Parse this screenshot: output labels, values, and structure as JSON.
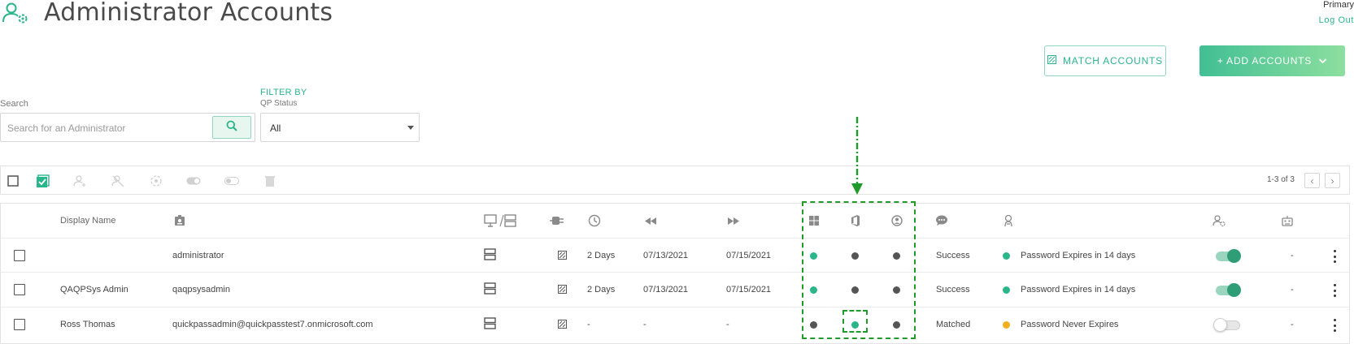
{
  "header": {
    "title": "Administrator Accounts",
    "account_label": "Primary",
    "logout_label": "Log Out"
  },
  "actions": {
    "match_label": "MATCH ACCOUNTS",
    "add_label": "+ ADD ACCOUNTS"
  },
  "search": {
    "label": "Search",
    "placeholder": "Search for an Administrator",
    "value": ""
  },
  "filter": {
    "heading": "FILTER BY",
    "label": "QP Status",
    "selected": "All"
  },
  "toolbar": {
    "page_count": "1-3 of 3"
  },
  "table": {
    "headers": {
      "display_name": "Display Name"
    },
    "rows": [
      {
        "display_name": "",
        "username": "administrator",
        "interval": "2 Days",
        "last_reset": "07/13/2021",
        "next_reset": "07/15/2021",
        "windows": "green",
        "office": "gray",
        "azure": "gray",
        "status": "Success",
        "password_dot": "green",
        "password": "Password Expires in 14 days",
        "enabled": true,
        "admin": "-"
      },
      {
        "display_name": "QAQPSys Admin",
        "username": "qaqpsysadmin",
        "interval": "2 Days",
        "last_reset": "07/13/2021",
        "next_reset": "07/15/2021",
        "windows": "green",
        "office": "gray",
        "azure": "gray",
        "status": "Success",
        "password_dot": "green",
        "password": "Password Expires in 14 days",
        "enabled": true,
        "admin": "-"
      },
      {
        "display_name": "Ross Thomas",
        "username": "quickpassadmin@quickpasstest7.onmicrosoft.com",
        "interval": "-",
        "last_reset": "-",
        "next_reset": "-",
        "windows": "gray",
        "office": "green",
        "azure": "gray",
        "status": "Matched",
        "password_dot": "yellow",
        "password": "Password Never Expires",
        "enabled": false,
        "admin": "-"
      }
    ]
  },
  "colors": {
    "accent": "#2bb58a",
    "green": "#2bb58a",
    "gray": "#555555",
    "yellow": "#f2b01e",
    "annotation": "#1f9a2b"
  },
  "icons": {
    "header": "admin-user-gear-icon",
    "toolbar": [
      "select-all-checkbox",
      "bulk-select-icon",
      "add-user-icon",
      "remove-user-icon",
      "reset-icon",
      "toggle-on-icon",
      "toggle-off-icon",
      "trash-icon"
    ],
    "columns": [
      "id-badge-icon",
      "device-server-icon",
      "plug-icon",
      "clock-icon",
      "rewind-icon",
      "fast-forward-icon",
      "windows-icon",
      "office-icon",
      "azure-user-icon",
      "chat-icon",
      "password-icon",
      "admin-icon",
      "robot-icon"
    ]
  }
}
